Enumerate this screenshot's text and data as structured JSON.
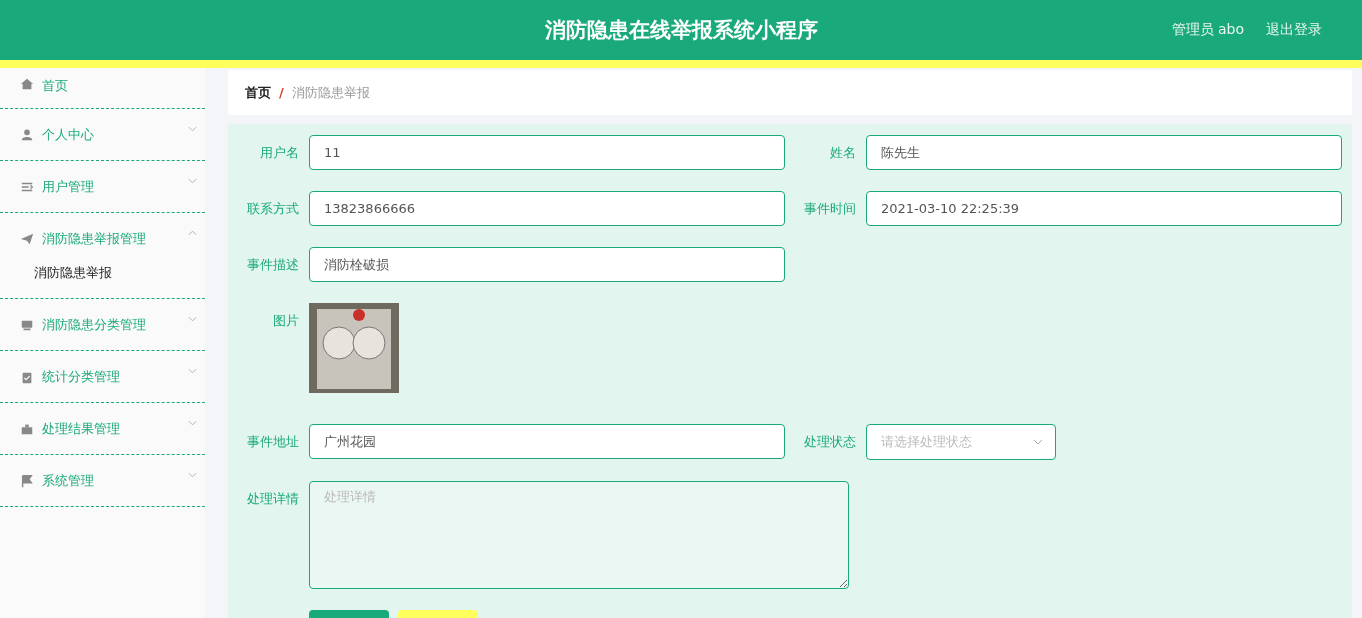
{
  "header": {
    "title": "消防隐患在线举报系统小程序",
    "user": "管理员 abo",
    "logout": "退出登录"
  },
  "sidebar": {
    "items": [
      {
        "label": "首页"
      },
      {
        "label": "个人中心",
        "expanded": false
      },
      {
        "label": "用户管理",
        "expanded": false
      },
      {
        "label": "消防隐患举报管理",
        "expanded": true,
        "children": [
          {
            "label": "消防隐患举报"
          }
        ]
      },
      {
        "label": "消防隐患分类管理",
        "expanded": false
      },
      {
        "label": "统计分类管理",
        "expanded": false
      },
      {
        "label": "处理结果管理",
        "expanded": false
      },
      {
        "label": "系统管理",
        "expanded": false
      }
    ]
  },
  "breadcrumb": {
    "items": [
      "首页",
      "消防隐患举报"
    ],
    "separator": "/"
  },
  "form": {
    "fields": [
      {
        "kind": "input",
        "label": "用户名",
        "value": "11"
      },
      {
        "kind": "input",
        "label": "姓名",
        "value": "陈先生"
      },
      {
        "kind": "input",
        "label": "联系方式",
        "value": "13823866666"
      },
      {
        "kind": "input",
        "label": "事件时间",
        "value": "2021-03-10 22:25:39"
      },
      {
        "kind": "input",
        "label": "事件描述",
        "value": "消防栓破损"
      },
      {
        "kind": "image",
        "label": "图片"
      },
      {
        "kind": "input",
        "label": "事件地址",
        "value": "广州花园"
      },
      {
        "kind": "select",
        "label": "处理状态",
        "placeholder": "请选择处理状态"
      },
      {
        "kind": "textarea",
        "label": "处理详情",
        "placeholder": "处理详情"
      }
    ],
    "buttons": [
      {
        "kind": "primary"
      },
      {
        "kind": "secondary"
      }
    ]
  }
}
